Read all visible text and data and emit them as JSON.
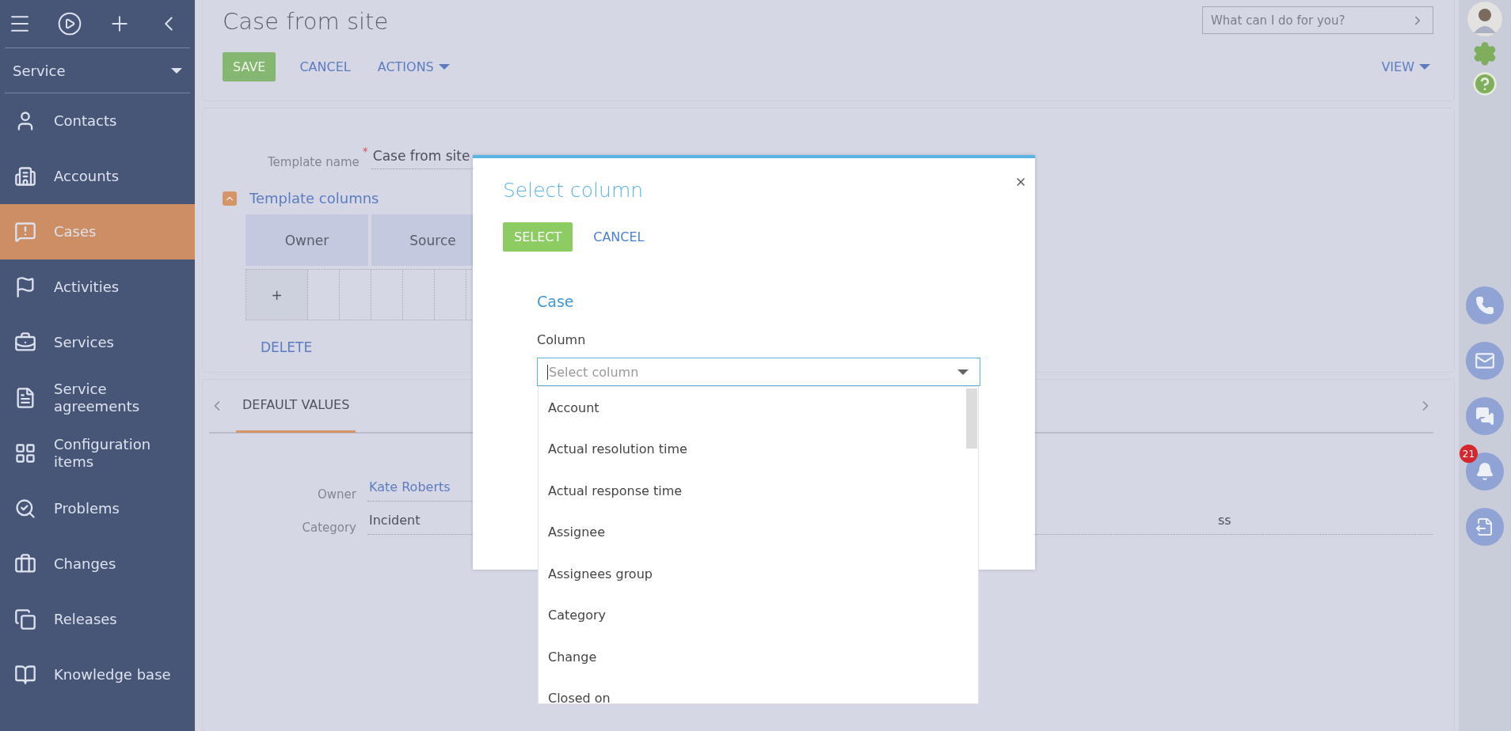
{
  "sidebar": {
    "workplace": "Service",
    "items": [
      {
        "label": "Contacts",
        "selected": false
      },
      {
        "label": "Accounts",
        "selected": false
      },
      {
        "label": "Cases",
        "selected": true
      },
      {
        "label": "Activities",
        "selected": false
      },
      {
        "label": "Services",
        "selected": false
      },
      {
        "label": "Service agreements",
        "selected": false
      },
      {
        "label": "Configuration items",
        "selected": false
      },
      {
        "label": "Problems",
        "selected": false
      },
      {
        "label": "Changes",
        "selected": false
      },
      {
        "label": "Releases",
        "selected": false
      },
      {
        "label": "Knowledge base",
        "selected": false
      }
    ]
  },
  "header": {
    "title": "Case from site",
    "search": {
      "placeholder": "What can I do for you?"
    },
    "buttons": [
      {
        "label": "SAVE",
        "kind": "primary"
      },
      {
        "label": "CANCEL",
        "kind": "link"
      },
      {
        "label": "ACTIONS",
        "kind": "menu"
      }
    ],
    "view": "VIEW"
  },
  "form": {
    "template_name": {
      "label": "Template name",
      "required_mark": "*",
      "value": "Case from site"
    },
    "section": {
      "title": "Template columns",
      "expanded": true
    },
    "columns": [
      "Owner",
      "Source"
    ],
    "add": "+",
    "delete": "DELETE"
  },
  "details": {
    "tabs": [
      {
        "label": "DEFAULT VALUES",
        "selected": true
      }
    ],
    "fields": [
      {
        "label": "Owner",
        "value": "Kate Roberts",
        "kind": "link"
      },
      {
        "label": "Category",
        "value": "Incident",
        "kind": "text"
      }
    ],
    "partial_value": "ss"
  },
  "rail": {
    "notifications": "21"
  },
  "modal": {
    "title": "Select column",
    "buttons": [
      {
        "label": "SELECT",
        "kind": "primary"
      },
      {
        "label": "CANCEL",
        "kind": "link"
      }
    ],
    "section": "Case",
    "field_label": "Column",
    "placeholder": "Select column",
    "options": [
      "Account",
      "Actual resolution time",
      "Actual response time",
      "Assignee",
      "Assignees group",
      "Category",
      "Change",
      "Closed on"
    ]
  }
}
